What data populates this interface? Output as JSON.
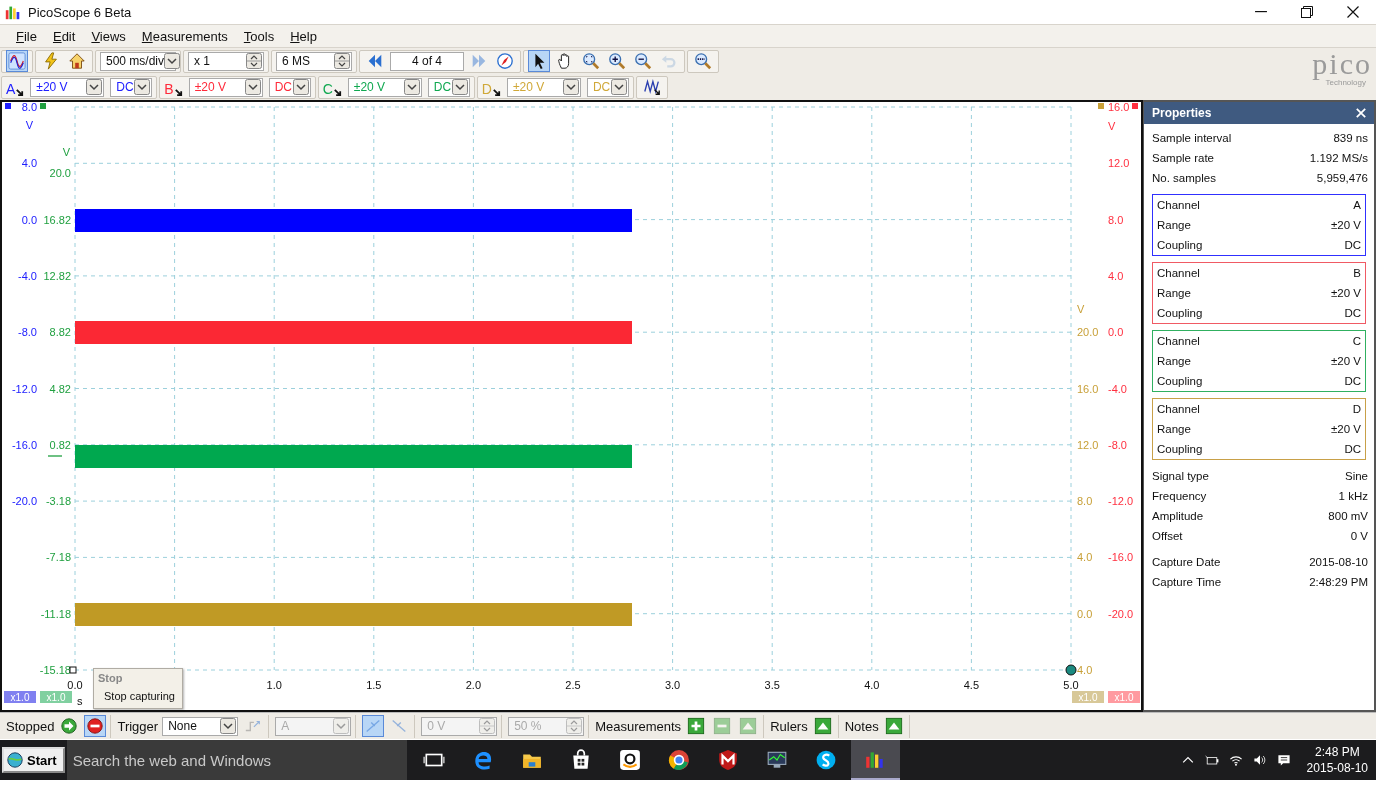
{
  "window": {
    "title": "PicoScope 6 Beta"
  },
  "menu": [
    "File",
    "Edit",
    "Views",
    "Measurements",
    "Tools",
    "Help"
  ],
  "logo": {
    "brand": "pico",
    "tagline": "Technology"
  },
  "toolbar": [
    [
      {
        "kind": "button",
        "selected": true,
        "disabled": false
      }
    ],
    [
      {
        "kind": "button",
        "selected": false,
        "disabled": false
      },
      {
        "kind": "button",
        "selected": false,
        "disabled": false
      }
    ],
    [
      {
        "kind": "dropdown",
        "value": "500 ms/div",
        "disabled": false
      }
    ],
    [
      {
        "kind": "spin",
        "value": "x 1",
        "disabled": false
      }
    ],
    [
      {
        "kind": "spin",
        "value": "6 MS",
        "disabled": false
      }
    ],
    [
      {
        "kind": "button",
        "selected": false,
        "disabled": false
      },
      {
        "kind": "field",
        "value": "4 of 4"
      },
      {
        "kind": "button",
        "selected": false,
        "disabled": true
      },
      {
        "kind": "button",
        "selected": false,
        "disabled": false
      }
    ],
    [
      {
        "kind": "button",
        "selected": true,
        "disabled": false
      },
      {
        "kind": "button",
        "selected": false,
        "disabled": false
      },
      {
        "kind": "button",
        "selected": false,
        "disabled": false
      },
      {
        "kind": "button",
        "selected": false,
        "disabled": false
      },
      {
        "kind": "button",
        "selected": false,
        "disabled": false
      },
      {
        "kind": "button",
        "selected": false,
        "disabled": true
      }
    ],
    [
      {
        "kind": "button",
        "selected": false,
        "disabled": false
      }
    ]
  ],
  "channels": [
    {
      "letter": "A",
      "color": "#2020ff",
      "range": "±20 V",
      "coupling": "DC"
    },
    {
      "letter": "B",
      "color": "#ff2a3a",
      "range": "±20 V",
      "coupling": "DC"
    },
    {
      "letter": "C",
      "color": "#10a850",
      "range": "±20 V",
      "coupling": "DC"
    },
    {
      "letter": "D",
      "color": "#d0a838",
      "range": "±20 V",
      "coupling": "DC"
    }
  ],
  "scope": {
    "axes": [
      {
        "unit": "V",
        "color": "#2020ff",
        "labels": [
          "8.0",
          "4.0",
          "0.0",
          "-4.0",
          "-8.0",
          "-12.0",
          "-16.0",
          "-20.0"
        ]
      },
      {
        "unit": "V",
        "color": "#20a040",
        "labels": [
          "20.0",
          "16.82",
          "12.82",
          "8.82",
          "4.82",
          "0.82",
          "-3.18",
          "-7.18",
          "-11.18",
          "-15.18"
        ]
      },
      {
        "unit": "V",
        "color": "#c8a038",
        "labels": [
          "20.0",
          "16.0",
          "12.0",
          "8.0",
          "4.0",
          "0.0",
          "4.0"
        ]
      },
      {
        "unit": "V",
        "color": "#ff3040",
        "labels": [
          "16.0",
          "12.0",
          "8.0",
          "4.0",
          "0.0",
          "-4.0",
          "-8.0",
          "-12.0",
          "-16.0",
          "-20.0"
        ]
      }
    ],
    "x_axis": {
      "unit": "s",
      "labels": [
        "0.0",
        "1.0",
        "1.5",
        "2.0",
        "2.5",
        "3.0",
        "3.5",
        "4.0",
        "4.5",
        "5.0"
      ]
    },
    "traces": [
      {
        "color": "#0000ff"
      },
      {
        "color": "#fb2834"
      },
      {
        "color": "#00a84f"
      },
      {
        "color": "#c09a25"
      }
    ],
    "scale_labels": [
      {
        "text": "x1.0",
        "color": "#8080f0"
      },
      {
        "text": "x1.0",
        "color": "#80d0a0"
      },
      {
        "text": "x1.0",
        "color": "#d8c898"
      },
      {
        "text": "x1.0",
        "color": "#ff9aa0"
      }
    ],
    "tooltip": {
      "title": "Stop",
      "text": "Stop capturing"
    }
  },
  "properties": {
    "title": "Properties",
    "general": [
      {
        "label": "Sample interval",
        "value": "839 ns"
      },
      {
        "label": "Sample rate",
        "value": "1.192 MS/s"
      },
      {
        "label": "No. samples",
        "value": "5,959,476"
      }
    ],
    "channels": [
      {
        "color": "#3030ff",
        "rows": [
          {
            "label": "Channel",
            "value": "A"
          },
          {
            "label": "Range",
            "value": "±20 V"
          },
          {
            "label": "Coupling",
            "value": "DC"
          }
        ]
      },
      {
        "color": "#f05a64",
        "rows": [
          {
            "label": "Channel",
            "value": "B"
          },
          {
            "label": "Range",
            "value": "±20 V"
          },
          {
            "label": "Coupling",
            "value": "DC"
          }
        ]
      },
      {
        "color": "#30b060",
        "rows": [
          {
            "label": "Channel",
            "value": "C"
          },
          {
            "label": "Range",
            "value": "±20 V"
          },
          {
            "label": "Coupling",
            "value": "DC"
          }
        ]
      },
      {
        "color": "#c8a048",
        "rows": [
          {
            "label": "Channel",
            "value": "D"
          },
          {
            "label": "Range",
            "value": "±20 V"
          },
          {
            "label": "Coupling",
            "value": "DC"
          }
        ]
      }
    ],
    "signal": [
      {
        "label": "Signal type",
        "value": "Sine"
      },
      {
        "label": "Frequency",
        "value": "1 kHz"
      },
      {
        "label": "Amplitude",
        "value": "800 mV"
      },
      {
        "label": "Offset",
        "value": "0 V"
      }
    ],
    "capture": [
      {
        "label": "Capture Date",
        "value": "2015-08-10"
      },
      {
        "label": "Capture Time",
        "value": "2:48:29 PM"
      }
    ]
  },
  "status_bar": [
    [
      {
        "kind": "label",
        "text": "Stopped"
      },
      {
        "kind": "button",
        "selected": false,
        "disabled": false
      },
      {
        "kind": "button",
        "selected": true,
        "disabled": false
      }
    ],
    [
      {
        "kind": "label",
        "text": "Trigger"
      },
      {
        "kind": "dropdown",
        "value": "None",
        "disabled": false
      },
      {
        "kind": "button",
        "selected": false,
        "disabled": true
      }
    ],
    [
      {
        "kind": "dropdown",
        "value": "A",
        "disabled": true
      }
    ],
    [
      {
        "kind": "button",
        "selected": true,
        "disabled": true
      },
      {
        "kind": "button",
        "selected": false,
        "disabled": true
      }
    ],
    [
      {
        "kind": "spin",
        "value": "0 V",
        "disabled": true
      }
    ],
    [
      {
        "kind": "spin",
        "value": "50 %",
        "disabled": true
      }
    ],
    [
      {
        "kind": "label",
        "text": "Measurements"
      },
      {
        "kind": "button",
        "selected": false,
        "disabled": false
      },
      {
        "kind": "button",
        "selected": false,
        "disabled": true
      },
      {
        "kind": "button",
        "selected": false,
        "disabled": true
      }
    ],
    [
      {
        "kind": "label",
        "text": "Rulers"
      },
      {
        "kind": "button",
        "selected": false,
        "disabled": false
      }
    ],
    [
      {
        "kind": "label",
        "text": "Notes"
      },
      {
        "kind": "button",
        "selected": false,
        "disabled": false
      }
    ]
  ],
  "taskbar": {
    "start": "Start",
    "search": {
      "placeholder": "Search the web and Windows"
    },
    "apps": [
      {
        "active": false
      },
      {
        "active": false
      },
      {
        "active": false
      },
      {
        "active": false
      },
      {
        "active": false
      },
      {
        "active": false
      },
      {
        "active": false
      },
      {
        "active": false
      },
      {
        "active": false
      },
      {
        "active": true
      }
    ],
    "clock": {
      "time": "2:48 PM",
      "date": "2015-08-10"
    }
  }
}
